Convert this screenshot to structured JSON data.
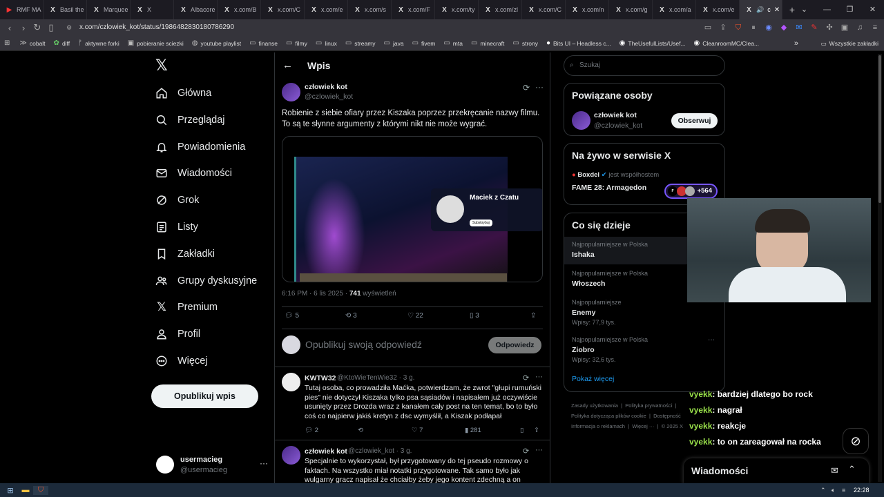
{
  "browser": {
    "tabs": [
      "RMF MA",
      "Basil the",
      "Marquee",
      "X",
      "Albacore",
      "x.com/B",
      "x.com/C",
      "x.com/e",
      "x.com/s",
      "x.com/F",
      "x.com/ty",
      "x.com/zl",
      "x.com/C",
      "x.com/n",
      "x.com/g",
      "x.com/a",
      "x.com/e",
      "c"
    ],
    "url": "x.com/czlowiek_kot/status/1986482830180786290",
    "bookmarks": [
      "cobalt",
      "diff",
      "aktywne forki",
      "pobieranie sciezki",
      "youtube playlist",
      "finanse",
      "filmy",
      "linux",
      "streamy",
      "java",
      "fivem",
      "mta",
      "minecraft",
      "strony",
      "Bits UI – Headless c...",
      "TheUsefulLists/Usef...",
      "CleanroomMC/Clea..."
    ],
    "bookmarks_right": "Wszystkie zakładki"
  },
  "nav": {
    "items": [
      {
        "label": "Główna",
        "icon": "home-icon"
      },
      {
        "label": "Przeglądaj",
        "icon": "search-icon"
      },
      {
        "label": "Powiadomienia",
        "icon": "bell-icon"
      },
      {
        "label": "Wiadomości",
        "icon": "mail-icon"
      },
      {
        "label": "Grok",
        "icon": "grok-icon"
      },
      {
        "label": "Listy",
        "icon": "list-icon"
      },
      {
        "label": "Zakładki",
        "icon": "bookmark-icon"
      },
      {
        "label": "Grupy dyskusyjne",
        "icon": "people-icon"
      },
      {
        "label": "Premium",
        "icon": "x-logo-icon"
      },
      {
        "label": "Profil",
        "icon": "person-icon"
      },
      {
        "label": "Więcej",
        "icon": "more-circle-icon"
      }
    ],
    "post_button": "Opublikuj wpis",
    "account": {
      "name": "usermacieg",
      "handle": "@usermacieg"
    }
  },
  "main": {
    "header_title": "Wpis",
    "tweet": {
      "author": "człowiek kot",
      "handle": "@czlowiek_kot",
      "text": "Robienie z siebie ofiary przez Kiszaka poprzez przekręcanie nazwy filmu. To są te słynne argumenty z którymi nikt nie może wygrać.",
      "media_name": "Maciek z Czatu",
      "media_button": "Subskrybuj",
      "time": "6:16 PM · 6 lis 2025 · ",
      "views": "741",
      "views_label": " wyświetleń",
      "stats": {
        "replies": "5",
        "reposts": "3",
        "likes": "22",
        "bookmarks": "3"
      }
    },
    "reply_placeholder": "Opublikuj swoją odpowiedź",
    "reply_button": "Odpowiedz",
    "replies": [
      {
        "author": "KWTW32",
        "handle": "@KtoWieTenWie32 · 3 g.",
        "text": "Tutaj osoba, co prowadziła Maćka, potwierdzam, że zwrot \"głupi rumuński pies\" nie dotyczył Kiszaka tylko psa sąsiadów i napisałem już oczywiście usunięty przez Drozda wraz z kanałem cały post na ten temat, bo to było coś co najpierw jakiś kretyn z dsc wymyślił, a Kiszak podłapał",
        "stats": {
          "replies": "2",
          "reposts": "",
          "likes": "7",
          "views": "281"
        }
      },
      {
        "author": "człowiek kot",
        "handle": "@czlowiek_kot · 3 g.",
        "text": "Specjalnie to wykorzystał, był przygotowany do tej pseudo rozmowy o faktach. Na wszystko miał notatki przygotowane. Tak samo było jak wulgarny gracz napisał że chciałby żeby jego kontent zdechną a on zaczął"
      }
    ]
  },
  "right": {
    "search_placeholder": "Szukaj",
    "related": {
      "title": "Powiązane osoby",
      "name": "człowiek kot",
      "handle": "@czlowiek_kot",
      "follow": "Obserwuj"
    },
    "live": {
      "title": "Na żywo w serwisie X",
      "host": "Boxdel",
      "cohost": "jest współhostem",
      "event": "FAME 28: Armagedon",
      "count": "+564"
    },
    "trends": {
      "title": "Co się dzieje",
      "items": [
        {
          "context": "Najpopularniejsze w Polska",
          "name": "Ishaka",
          "posts": ""
        },
        {
          "context": "Najpopularniejsze w Polska",
          "name": "Włoszech",
          "posts": ""
        },
        {
          "context": "Najpopularniejsze",
          "name": "Enemy",
          "posts": "Wpisy: 77,9 tys."
        },
        {
          "context": "Najpopularniejsze w Polska",
          "name": "Ziobro",
          "posts": "Wpisy: 32,6 tys."
        }
      ],
      "more": "Pokaż więcej"
    },
    "footer": [
      "Zasady użytkowania",
      "Polityka prywatności",
      "Polityka dotycząca plików cookie",
      "Dostępność",
      "Informacja o reklamach",
      "Więcej ···",
      "© 2025 X"
    ]
  },
  "overlay": {
    "chat": [
      {
        "user": "vyekk",
        "msg": "bardziej dlatego bo rock"
      },
      {
        "user": "vyekk",
        "msg": "nagrał"
      },
      {
        "user": "vyekk",
        "msg": "reakcje"
      },
      {
        "user": "vyekk",
        "msg": "to on zareagował na rocka"
      }
    ],
    "dm_title": "Wiadomości"
  },
  "taskbar": {
    "time": "22:28"
  }
}
